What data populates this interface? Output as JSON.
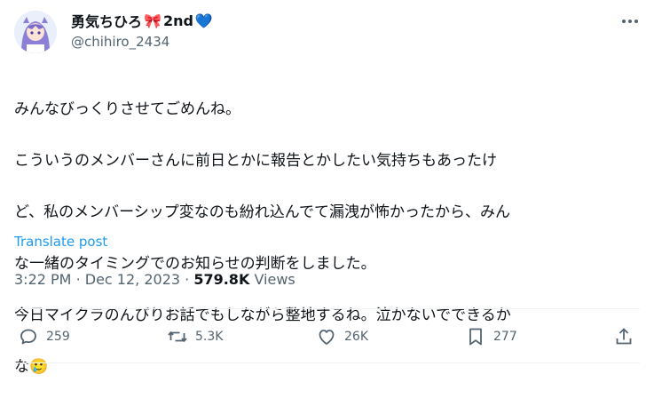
{
  "author": {
    "display_name": "勇気ちひろ",
    "name_emoji_1": "🎀",
    "name_suffix": "2nd",
    "name_emoji_2": "💙",
    "handle": "@chihiro_2434"
  },
  "post": {
    "text_lines": [
      "みんなびっくりさせてごめんね。",
      "こういうのメンバーさんに前日とかに報告とかしたい気持ちもあったけ",
      "ど、私のメンバーシップ変なのも紛れ込んでて漏洩が怖かったから、みん",
      "な一緒のタイミングでのお知らせの判断をしました。",
      "今日マイクラのんびりお話でもしながら整地するね。泣かないでできるか",
      "な"
    ],
    "trailing_emoji": "🥲",
    "translate_label": "Translate post"
  },
  "meta": {
    "time": "3:22 PM",
    "separator": "·",
    "date": "Dec 12, 2023",
    "views_count": "579.8K",
    "views_label": "Views"
  },
  "actions": {
    "replies": "259",
    "reposts": "5.3K",
    "likes": "26K",
    "bookmarks": "277"
  },
  "colors": {
    "link": "#1d9bf0",
    "secondary": "#536471",
    "text": "#0f1419",
    "divider": "#eff3f4"
  },
  "icons": [
    "more-icon",
    "reply-icon",
    "repost-icon",
    "like-icon",
    "bookmark-icon",
    "share-icon"
  ]
}
